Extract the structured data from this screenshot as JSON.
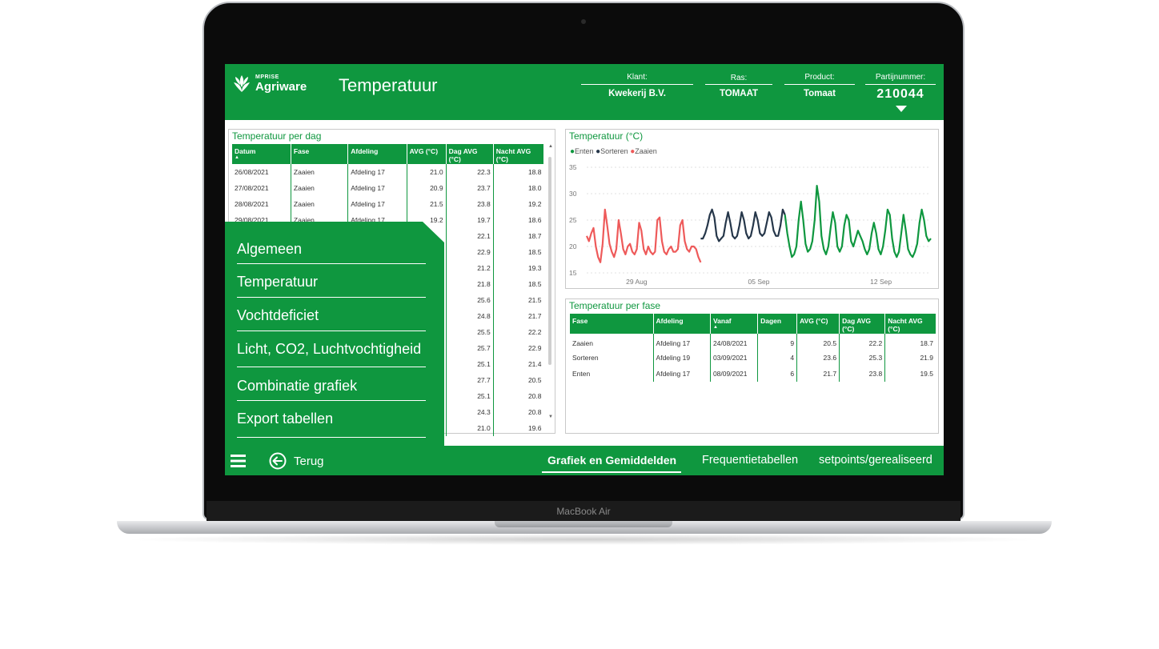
{
  "device": {
    "label": "MacBook Air"
  },
  "header": {
    "brand_small": "MPRISE",
    "brand": "Agriware",
    "title": "Temperatuur",
    "klant_label": "Klant:",
    "klant_value": "Kwekerij  B.V.",
    "ras_label": "Ras:",
    "ras_value": "TOMAAT",
    "product_label": "Product:",
    "product_value": "Tomaat",
    "partij_label": "Partijnummer:",
    "partij_value": "210044"
  },
  "day_table": {
    "title": "Temperatuur per dag",
    "columns": [
      "Datum",
      "Fase",
      "Afdeling",
      "AVG (°C)",
      "Dag AVG (°C)",
      "Nacht AVG (°C)"
    ],
    "sort_indicator": "▲",
    "rows": [
      [
        "26/08/2021",
        "Zaaien",
        "Afdeling 17",
        "21.0",
        "22.3",
        "18.8"
      ],
      [
        "27/08/2021",
        "Zaaien",
        "Afdeling 17",
        "20.9",
        "23.7",
        "18.0"
      ],
      [
        "28/08/2021",
        "Zaaien",
        "Afdeling 17",
        "21.5",
        "23.8",
        "19.2"
      ],
      [
        "29/08/2021",
        "Zaaien",
        "Afdeling 17",
        "19.2",
        "19.7",
        "18.6"
      ],
      [
        "",
        "",
        "",
        "",
        "22.1",
        "18.7"
      ],
      [
        "",
        "",
        "",
        "",
        "22.9",
        "18.5"
      ],
      [
        "",
        "",
        "",
        "",
        "21.2",
        "19.3"
      ],
      [
        "",
        "",
        "",
        "",
        "21.8",
        "18.5"
      ],
      [
        "",
        "",
        "",
        "",
        "25.6",
        "21.5"
      ],
      [
        "",
        "",
        "",
        "",
        "24.8",
        "21.7"
      ],
      [
        "",
        "",
        "",
        "",
        "25.5",
        "22.2"
      ],
      [
        "",
        "",
        "",
        "",
        "25.7",
        "22.9"
      ],
      [
        "",
        "",
        "",
        "",
        "25.1",
        "21.4"
      ],
      [
        "",
        "",
        "",
        "",
        "27.7",
        "20.5"
      ],
      [
        "",
        "",
        "",
        "",
        "25.1",
        "20.8"
      ],
      [
        "",
        "",
        "",
        "",
        "24.3",
        "20.8"
      ],
      [
        "",
        "",
        "",
        "",
        "21.0",
        "19.6"
      ]
    ]
  },
  "chart_panel": {
    "title": "Temperatuur (°C)",
    "legend": [
      {
        "name": "Enten",
        "color": "#0f973f"
      },
      {
        "name": "Sorteren",
        "color": "#26374a"
      },
      {
        "name": "Zaaien",
        "color": "#ee5a5a"
      }
    ]
  },
  "chart_data": {
    "type": "line",
    "title": "Temperatuur (°C)",
    "ylim": [
      15,
      35
    ],
    "yticks": [
      15,
      20,
      25,
      30,
      35
    ],
    "xticks": [
      "29 Aug",
      "05 Sep",
      "12 Sep"
    ],
    "grid": true,
    "legend_position": "top-left",
    "series": [
      {
        "name": "Zaaien",
        "color": "#ee5a5a",
        "t_start": 0,
        "values": [
          22,
          21,
          22.5,
          23.5,
          20,
          18,
          17,
          20.5,
          27,
          24,
          20.5,
          19,
          18,
          19.5,
          25,
          22.5,
          19.5,
          18.5,
          20,
          20.5,
          19,
          18.5,
          19.5,
          24.5,
          23,
          19.5,
          18.5,
          20,
          19,
          18.5,
          19,
          25,
          25.5,
          21,
          19,
          18.5,
          19.5,
          20,
          19,
          19,
          19.5,
          24,
          25,
          21,
          19.5,
          19,
          20,
          20,
          19.5,
          18,
          17
        ]
      },
      {
        "name": "Sorteren",
        "color": "#26374a",
        "t_start": 50,
        "values": [
          21.5,
          21.5,
          22.5,
          24,
          26,
          27,
          25.5,
          22,
          21,
          21.5,
          22,
          24.5,
          26.5,
          24.5,
          22,
          21.5,
          22,
          24,
          26.5,
          25,
          22.5,
          21.5,
          22,
          24,
          26.5,
          25,
          22.5,
          22,
          22.5,
          24.5,
          26.5,
          25.5,
          23,
          22,
          22,
          24,
          27,
          26
        ]
      },
      {
        "name": "Enten",
        "color": "#0f973f",
        "t_start": 87,
        "values": [
          26,
          22.5,
          20,
          18,
          18.5,
          20,
          25,
          28.5,
          25,
          20.5,
          19,
          19.5,
          21,
          25,
          31.5,
          28.5,
          22,
          19.5,
          18.5,
          20,
          23.5,
          26.5,
          24.5,
          20,
          19,
          20,
          24,
          26,
          25,
          21,
          20,
          21.5,
          23,
          22,
          21,
          19.5,
          18.5,
          19.5,
          22.5,
          24.5,
          22.5,
          19.5,
          18.5,
          20,
          23,
          27,
          26,
          21.5,
          19,
          18,
          19,
          22.5,
          26,
          23,
          19.5,
          18.5,
          18,
          19,
          20.5,
          24.5,
          27,
          25,
          22,
          21,
          21.5
        ]
      }
    ]
  },
  "phase_table": {
    "title": "Temperatuur per fase",
    "columns": [
      "Fase",
      "Afdeling",
      "Vanaf",
      "Dagen",
      "AVG (°C)",
      "Dag AVG (°C)",
      "Nacht AVG (°C)"
    ],
    "sort_indicator": "▲",
    "rows": [
      [
        "Zaaien",
        "Afdeling 17",
        "24/08/2021",
        "9",
        "20.5",
        "22.2",
        "18.7"
      ],
      [
        "Sorteren",
        "Afdeling 19",
        "03/09/2021",
        "4",
        "23.6",
        "25.3",
        "21.9"
      ],
      [
        "Enten",
        "Afdeling 17",
        "08/09/2021",
        "6",
        "21.7",
        "23.8",
        "19.5"
      ]
    ]
  },
  "menu": {
    "items": [
      "Algemeen",
      "Temperatuur",
      "Vochtdeficiet",
      "Licht, CO2, Luchtvochtigheid",
      "Combinatie grafiek",
      "Export tabellen"
    ]
  },
  "footer": {
    "back_label": "Terug",
    "tabs": [
      "Grafiek en Gemiddelden",
      "Frequentietabellen",
      "setpoints/gerealiseerd"
    ],
    "active_tab": "Grafiek en Gemiddelden"
  }
}
